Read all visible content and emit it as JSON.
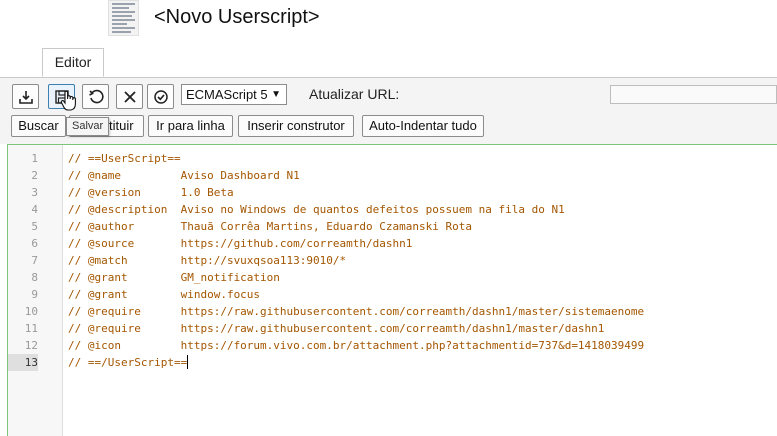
{
  "header": {
    "title": "<Novo Userscript>",
    "thumbnail_icon": "script-thumbnail"
  },
  "tabs": [
    {
      "label": "Editor",
      "active": true
    }
  ],
  "toolbar": {
    "icons": [
      "download-icon",
      "save-icon",
      "reset-icon",
      "close-icon",
      "check-icon"
    ],
    "language_select": {
      "value": "ECMAScript 5"
    },
    "url_label": "Atualizar URL:",
    "url_value": "",
    "buttons": {
      "search": "Buscar",
      "replace": "Substituir",
      "goto_line": "Ir para linha",
      "insert_constructor": "Inserir construtor",
      "auto_indent": "Auto-Indentar tudo"
    },
    "tooltip": "Salvar"
  },
  "editor": {
    "active_line": 13,
    "line_numbers": [
      "1",
      "2",
      "3",
      "4",
      "5",
      "6",
      "7",
      "8",
      "9",
      "10",
      "11",
      "12",
      "13"
    ],
    "lines": [
      "// ==UserScript==",
      "// @name         Aviso Dashboard N1",
      "// @version      1.0 Beta",
      "// @description  Aviso no Windows de quantos defeitos possuem na fila do N1",
      "// @author       Thauã Corrêa Martins, Eduardo Czamanski Rota",
      "// @source       https://github.com/correamth/dashn1",
      "// @match        http://svuxqsoa113:9010/*",
      "// @grant        GM_notification",
      "// @grant        window.focus",
      "// @require      https://raw.githubusercontent.com/correamth/dashn1/master/sistemaenome",
      "// @require      https://raw.githubusercontent.com/correamth/dashn1/master/dashn1",
      "// @icon         https://forum.vivo.com.br/attachment.php?attachmentid=737&d=1418039499",
      "// ==/UserScript=="
    ]
  },
  "colors": {
    "comment": "#a45600",
    "editor_border": "#7ec57c"
  }
}
